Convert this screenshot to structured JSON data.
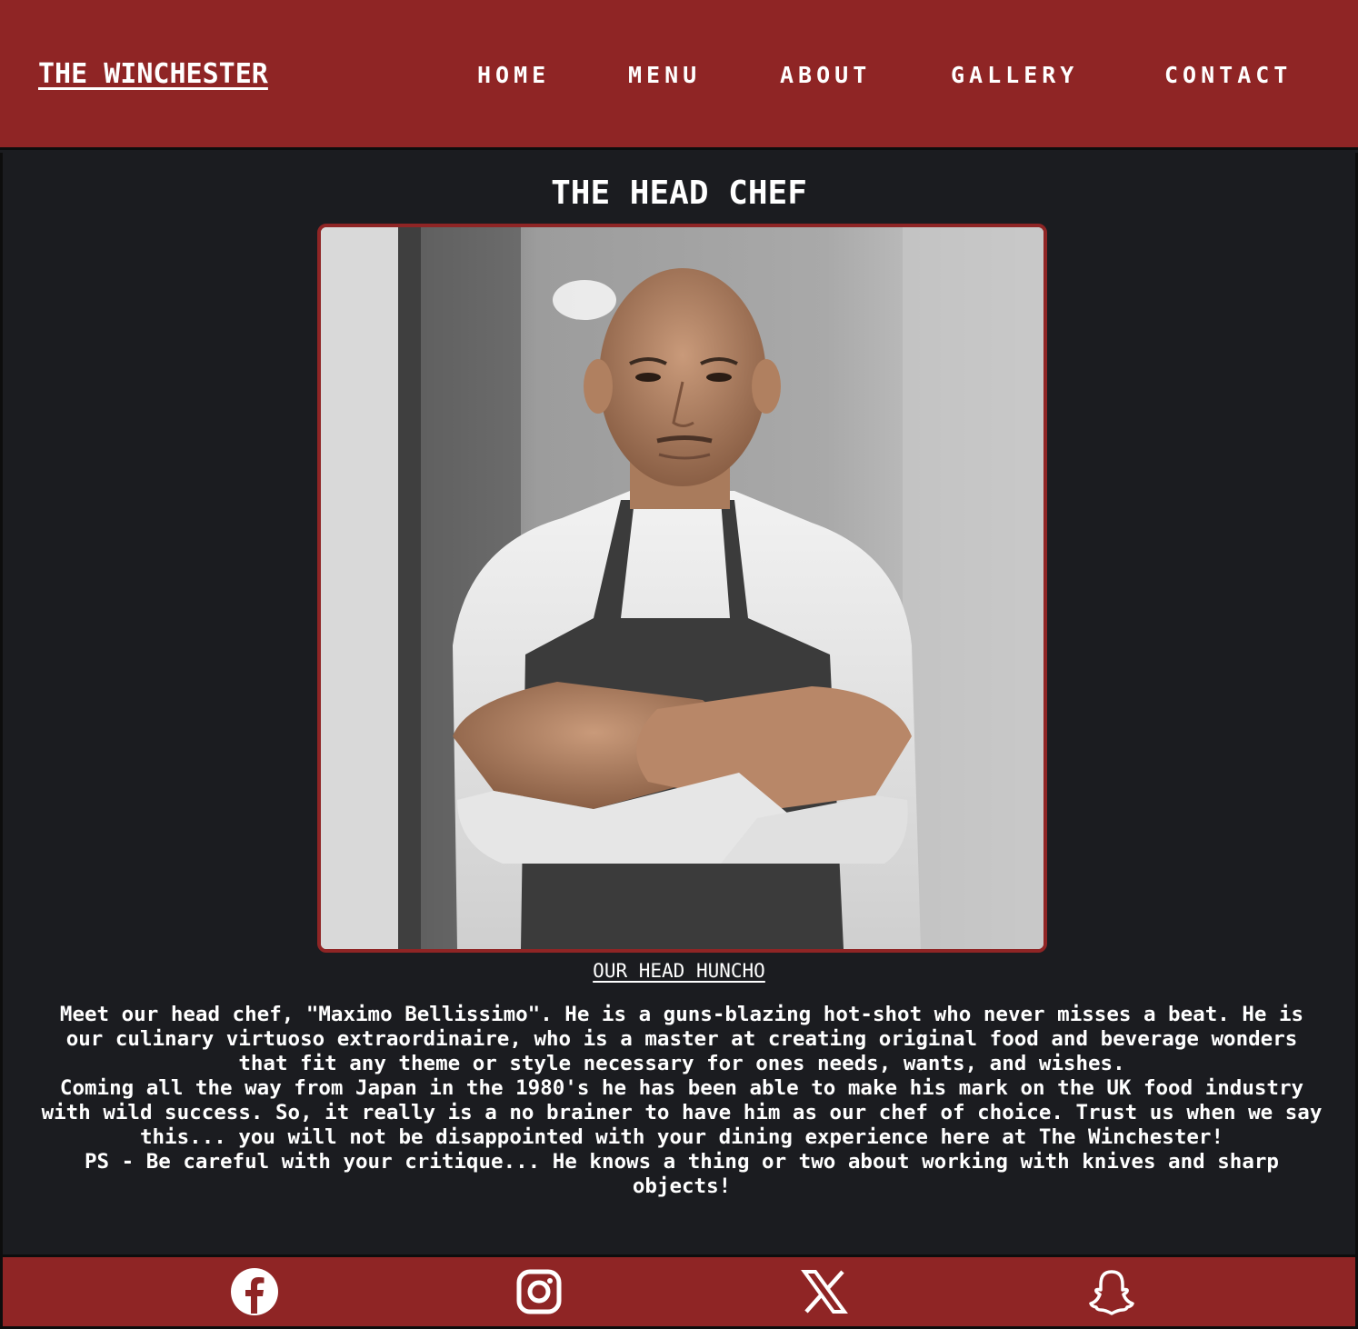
{
  "header": {
    "brand": "THE WINCHESTER",
    "nav": [
      {
        "label": "HOME",
        "id": "home"
      },
      {
        "label": "MENU",
        "id": "menu"
      },
      {
        "label": "ABOUT",
        "id": "about"
      },
      {
        "label": "GALLERY",
        "id": "gallery"
      },
      {
        "label": "CONTACT",
        "id": "contact"
      }
    ]
  },
  "main": {
    "title": "THE HEAD CHEF",
    "caption": "OUR HEAD HUNCHO",
    "bio": [
      "Meet our head chef, \"Maximo Bellissimo\". He is a guns-blazing hot-shot who never misses a beat. He is our culinary virtuoso extraordinaire, who is a master at creating original food and beverage wonders that fit any theme or style necessary for ones needs, wants, and wishes.",
      "Coming all the way from Japan in the 1980's he has been able to make his mark on the UK food industry with wild success. So, it really is a no brainer to have him as our chef of choice. Trust us when we say this... you will not be disappointed with your dining experience here at The Winchester!",
      "PS - Be careful with your critique... He knows a thing or two about working with knives and sharp objects!"
    ]
  },
  "footer": {
    "social": [
      {
        "icon": "facebook-icon"
      },
      {
        "icon": "instagram-icon"
      },
      {
        "icon": "x-icon"
      },
      {
        "icon": "snapchat-icon"
      }
    ]
  },
  "colors": {
    "brand_red": "#8f2525",
    "background": "#1b1c20",
    "text": "#ffffff"
  }
}
